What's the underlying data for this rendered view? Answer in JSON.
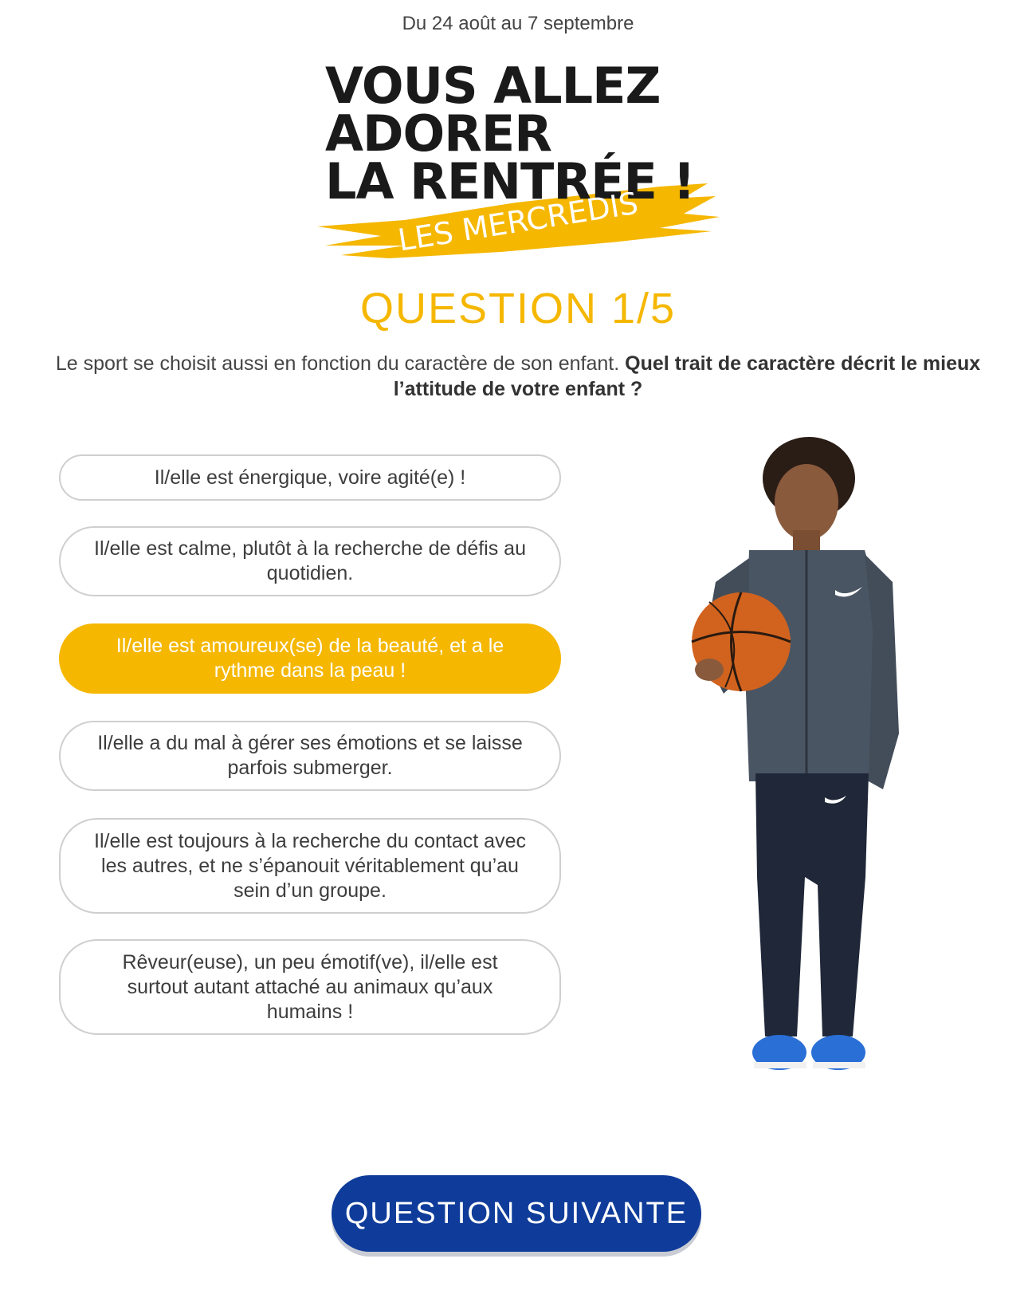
{
  "header": {
    "date_range": "Du 24 août au 7 septembre",
    "headline_line1": "VOUS ALLEZ",
    "headline_line2": "ADORER",
    "headline_line3": "LA RENTRÉE !",
    "brush_label": "LES MERCREDIS"
  },
  "question": {
    "title": "QUESTION 1/5",
    "intro": "Le sport se choisit aussi en fonction du caractère de son enfant. ",
    "prompt_bold": "Quel trait de caractère décrit le mieux l’attitude de votre enfant ?"
  },
  "answers": [
    {
      "label": "Il/elle est énergique, voire agité(e) !",
      "selected": false
    },
    {
      "label": "Il/elle est calme, plutôt à la recherche de défis au quotidien.",
      "selected": false
    },
    {
      "label": "Il/elle est amoureux(se) de la beauté, et a le rythme dans la peau !",
      "selected": true
    },
    {
      "label": "Il/elle a du mal à gérer ses émotions et se laisse parfois submerger.",
      "selected": false
    },
    {
      "label": "Il/elle est toujours à la recherche du contact avec les autres, et ne s’épanouit véritablement qu’au sein d’un groupe.",
      "selected": false
    },
    {
      "label": "Rêveur(euse), un peu émotif(ve), il/elle est surtout autant attaché au animaux qu’aux humains !",
      "selected": false
    }
  ],
  "next_button": {
    "label": "QUESTION SUIVANTE"
  },
  "colors": {
    "accent": "#f5b700",
    "button": "#0f3c9a",
    "text": "#3d3d3d"
  },
  "image": {
    "subject": "child-with-basketball",
    "logo_text": "NIKE"
  }
}
